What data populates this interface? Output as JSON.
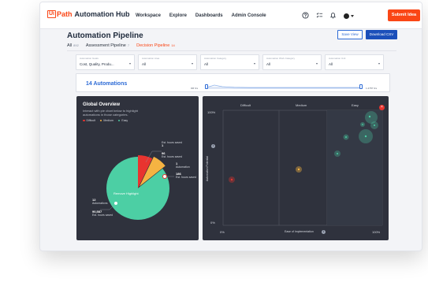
{
  "app": {
    "logo_box": "Ui",
    "logo_path": "Path",
    "logo_name": "Automation Hub",
    "nav": [
      "Workspace",
      "Explore",
      "Dashboards",
      "Admin Console"
    ],
    "submit_label": "Submit Idea",
    "accent": "#fa4616"
  },
  "page": {
    "title": "Automation Pipeline",
    "save_view": "Save View",
    "download_csv": "Download CSV",
    "tabs": [
      {
        "label": "All",
        "count": "892"
      },
      {
        "label": "Assessment Pipeline",
        "count": "7"
      },
      {
        "label": "Decision Pipeline",
        "count": "14"
      }
    ]
  },
  "filters": [
    {
      "label": "Automation Goals",
      "value": "Cost, Quality, Produ..."
    },
    {
      "label": "Automation Area",
      "value": "All"
    },
    {
      "label": "Automation Category",
      "value": "All"
    },
    {
      "label": "Automation Work Category",
      "value": "All"
    },
    {
      "label": "Automation Unit",
      "value": "All"
    }
  ],
  "count_bar": {
    "label": "14 Automations",
    "range_min": "0M hrs",
    "range_max": "1.2787 hrs"
  },
  "overview": {
    "title": "Global Overview",
    "description": "Interact with pie chart below to highlight automations in those categories.",
    "legend": [
      {
        "label": "Difficult",
        "color": "#e8342f"
      },
      {
        "label": "Medium",
        "color": "#f5b342"
      },
      {
        "label": "Easy",
        "color": "#4ccfa4"
      }
    ],
    "tooltip": "Remove Highlight",
    "labels": [
      {
        "value": "1",
        "text": "Automation"
      },
      {
        "value": "96",
        "text": "Est. hours saved"
      },
      {
        "value": "1",
        "text": "Automation"
      },
      {
        "value": "186",
        "text": "Est. hours saved"
      },
      {
        "value": "12",
        "text": "Automations"
      },
      {
        "value": "90,587",
        "text": "Est. hours saved"
      }
    ]
  },
  "matrix": {
    "columns": [
      "Difficult",
      "Medium",
      "Easy"
    ],
    "y_axis_label": "Automation Potential",
    "x_axis_label": "Ease of Implementation",
    "y_top": "100%",
    "y_bottom": "0%",
    "x_left": "0%",
    "x_right": "100%",
    "close_icon": "×",
    "info_icon": "i"
  },
  "chart_data": {
    "type": "pie",
    "title": "Global Overview",
    "categories": [
      "Easy",
      "Medium",
      "Difficult"
    ],
    "values": [
      12,
      1,
      1
    ],
    "hours_saved": [
      90587,
      96,
      186
    ],
    "colors": [
      "#4ccfa4",
      "#f5b342",
      "#e8342f"
    ]
  }
}
